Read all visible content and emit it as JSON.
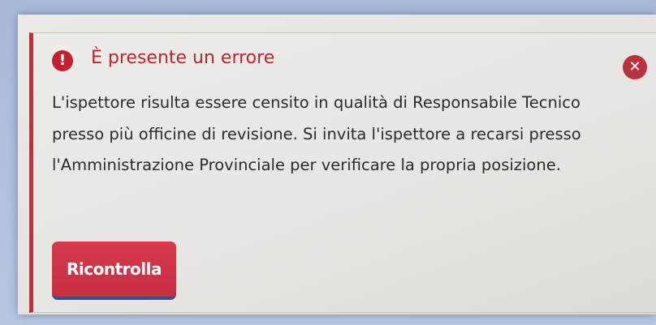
{
  "alert": {
    "icon": "exclamation-circle-icon",
    "close_icon": "close-icon",
    "title": "È presente un errore",
    "message": "L'ispettore risulta essere censito in qualità di Responsabile Tecnico presso più officine di revisione. Si invita l'ispettore a recarsi presso l'Amministrazione Provinciale per verificare la propria posizione.",
    "icon_glyph": "!",
    "close_glyph": "✕"
  },
  "actions": {
    "retry_label": "Ricontrolla"
  },
  "colors": {
    "error_red": "#bf2230",
    "button_red": "#d13447",
    "text": "#2b2b2b",
    "background": "#e9e7e4"
  }
}
